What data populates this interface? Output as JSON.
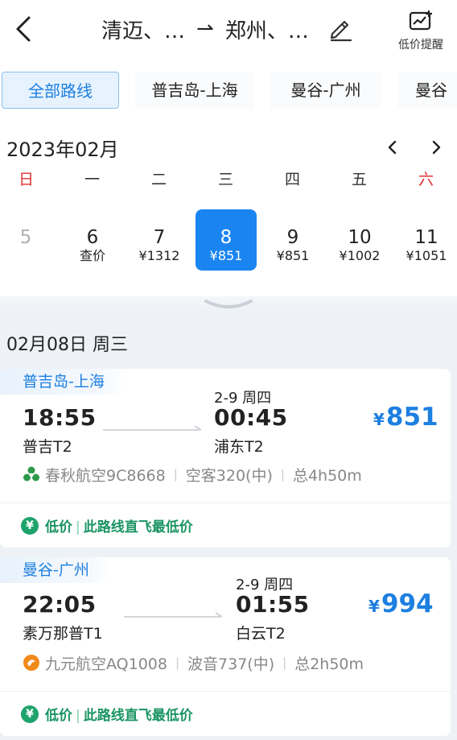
{
  "header": {
    "route_from": "清迈、…",
    "route_arrow": "⇀",
    "route_to": "郑州、…",
    "alert_label": "低价提醒"
  },
  "route_tabs": [
    {
      "label": "全部路线",
      "active": true
    },
    {
      "label": "普吉岛-上海",
      "active": false
    },
    {
      "label": "曼谷-广州",
      "active": false
    },
    {
      "label": "曼谷",
      "active": false
    }
  ],
  "calendar": {
    "month_label": "2023年02月",
    "weekdays": [
      "日",
      "一",
      "二",
      "三",
      "四",
      "五",
      "六"
    ],
    "dates": [
      {
        "day": "5",
        "price": ""
      },
      {
        "day": "6",
        "price": "查价"
      },
      {
        "day": "7",
        "price": "¥1312"
      },
      {
        "day": "8",
        "price": "¥851"
      },
      {
        "day": "9",
        "price": "¥851"
      },
      {
        "day": "10",
        "price": "¥1002"
      },
      {
        "day": "11",
        "price": "¥1051"
      }
    ],
    "selected_day": "8"
  },
  "date_heading": "02月08日 周三",
  "flights": [
    {
      "route_tag": "普吉岛-上海",
      "dep_time": "18:55",
      "dep_airport": "普吉T2",
      "arr_date": "2-9 周四",
      "arr_time": "00:45",
      "arr_airport": "浦东T2",
      "currency": "¥",
      "price": "851",
      "airline": "春秋航空9C8668",
      "aircraft": "空客320(中)",
      "duration": "总4h50m",
      "badge_icon": "¥",
      "badge_label": "低价",
      "badge_text": "此路线直飞最低价"
    },
    {
      "route_tag": "曼谷-广州",
      "dep_time": "22:05",
      "dep_airport": "素万那普T1",
      "arr_date": "2-9 周四",
      "arr_time": "01:55",
      "arr_airport": "白云T2",
      "currency": "¥",
      "price": "994",
      "airline": "九元航空AQ1008",
      "aircraft": "波音737(中)",
      "duration": "总2h50m",
      "badge_icon": "¥",
      "badge_label": "低价",
      "badge_text": "此路线直飞最低价"
    }
  ],
  "colors": {
    "accent": "#1a85f0",
    "price_blue": "#1d7fe0",
    "weekend_red": "#e03030",
    "lowprice_green": "#1fa36c"
  },
  "icons": [
    "back-arrow-icon",
    "edit-pencil-icon",
    "price-alert-chart-icon",
    "chevron-left-icon",
    "chevron-right-icon",
    "collapse-chevron-icon",
    "spring-airlines-logo-icon",
    "9air-logo-icon",
    "yuan-badge-icon"
  ]
}
